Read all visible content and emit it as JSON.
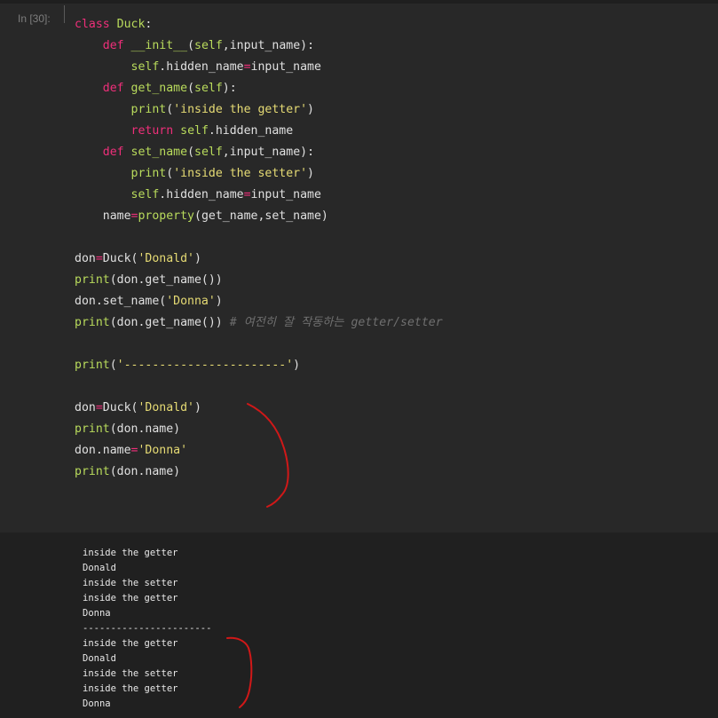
{
  "cell": {
    "prompt": "In [30]:",
    "code_lines": [
      [
        {
          "t": "kw",
          "v": "class"
        },
        {
          "t": "txt",
          "v": " "
        },
        {
          "t": "cls",
          "v": "Duck"
        },
        {
          "t": "txt",
          "v": ":"
        }
      ],
      [
        {
          "t": "txt",
          "v": "    "
        },
        {
          "t": "kw",
          "v": "def"
        },
        {
          "t": "txt",
          "v": " "
        },
        {
          "t": "bi",
          "v": "__init__"
        },
        {
          "t": "txt",
          "v": "("
        },
        {
          "t": "self",
          "v": "self"
        },
        {
          "t": "txt",
          "v": ",input_name):"
        }
      ],
      [
        {
          "t": "txt",
          "v": "        "
        },
        {
          "t": "self",
          "v": "self"
        },
        {
          "t": "txt",
          "v": ".hidden_name"
        },
        {
          "t": "op",
          "v": "="
        },
        {
          "t": "txt",
          "v": "input_name"
        }
      ],
      [
        {
          "t": "txt",
          "v": "    "
        },
        {
          "t": "kw",
          "v": "def"
        },
        {
          "t": "txt",
          "v": " "
        },
        {
          "t": "bi",
          "v": "get_name"
        },
        {
          "t": "txt",
          "v": "("
        },
        {
          "t": "self",
          "v": "self"
        },
        {
          "t": "txt",
          "v": "):"
        }
      ],
      [
        {
          "t": "txt",
          "v": "        "
        },
        {
          "t": "bi",
          "v": "print"
        },
        {
          "t": "txt",
          "v": "("
        },
        {
          "t": "str",
          "v": "'inside the getter'"
        },
        {
          "t": "txt",
          "v": ")"
        }
      ],
      [
        {
          "t": "txt",
          "v": "        "
        },
        {
          "t": "kw",
          "v": "return"
        },
        {
          "t": "txt",
          "v": " "
        },
        {
          "t": "self",
          "v": "self"
        },
        {
          "t": "txt",
          "v": ".hidden_name"
        }
      ],
      [
        {
          "t": "txt",
          "v": "    "
        },
        {
          "t": "kw",
          "v": "def"
        },
        {
          "t": "txt",
          "v": " "
        },
        {
          "t": "bi",
          "v": "set_name"
        },
        {
          "t": "txt",
          "v": "("
        },
        {
          "t": "self",
          "v": "self"
        },
        {
          "t": "txt",
          "v": ",input_name):"
        }
      ],
      [
        {
          "t": "txt",
          "v": "        "
        },
        {
          "t": "bi",
          "v": "print"
        },
        {
          "t": "txt",
          "v": "("
        },
        {
          "t": "str",
          "v": "'inside the setter'"
        },
        {
          "t": "txt",
          "v": ")"
        }
      ],
      [
        {
          "t": "txt",
          "v": "        "
        },
        {
          "t": "self",
          "v": "self"
        },
        {
          "t": "txt",
          "v": ".hidden_name"
        },
        {
          "t": "op",
          "v": "="
        },
        {
          "t": "txt",
          "v": "input_name"
        }
      ],
      [
        {
          "t": "txt",
          "v": "    name"
        },
        {
          "t": "op",
          "v": "="
        },
        {
          "t": "bi",
          "v": "property"
        },
        {
          "t": "txt",
          "v": "(get_name,set_name)"
        }
      ],
      [],
      [
        {
          "t": "txt",
          "v": "don"
        },
        {
          "t": "op",
          "v": "="
        },
        {
          "t": "txt",
          "v": "Duck("
        },
        {
          "t": "str",
          "v": "'Donald'"
        },
        {
          "t": "txt",
          "v": ")"
        }
      ],
      [
        {
          "t": "bi",
          "v": "print"
        },
        {
          "t": "txt",
          "v": "(don.get_name())"
        }
      ],
      [
        {
          "t": "txt",
          "v": "don.set_name("
        },
        {
          "t": "str",
          "v": "'Donna'"
        },
        {
          "t": "txt",
          "v": ")"
        }
      ],
      [
        {
          "t": "bi",
          "v": "print"
        },
        {
          "t": "txt",
          "v": "(don.get_name()) "
        },
        {
          "t": "cmt",
          "v": "# 여전히 잘 작동하는 getter/setter"
        }
      ],
      [],
      [
        {
          "t": "bi",
          "v": "print"
        },
        {
          "t": "txt",
          "v": "("
        },
        {
          "t": "str",
          "v": "'-----------------------'"
        },
        {
          "t": "txt",
          "v": ")"
        }
      ],
      [],
      [
        {
          "t": "txt",
          "v": "don"
        },
        {
          "t": "op",
          "v": "="
        },
        {
          "t": "txt",
          "v": "Duck("
        },
        {
          "t": "str",
          "v": "'Donald'"
        },
        {
          "t": "txt",
          "v": ")"
        }
      ],
      [
        {
          "t": "bi",
          "v": "print"
        },
        {
          "t": "txt",
          "v": "(don.name)"
        }
      ],
      [
        {
          "t": "txt",
          "v": "don.name"
        },
        {
          "t": "op",
          "v": "="
        },
        {
          "t": "str",
          "v": "'Donna'"
        }
      ],
      [
        {
          "t": "bi",
          "v": "print"
        },
        {
          "t": "txt",
          "v": "(don.name)"
        }
      ]
    ]
  },
  "output_lines": [
    "inside the getter",
    "Donald",
    "inside the setter",
    "inside the getter",
    "Donna",
    "-----------------------",
    "inside the getter",
    "Donald",
    "inside the setter",
    "inside the getter",
    "Donna"
  ],
  "colors": {
    "background": "#282828",
    "output_background": "#202020",
    "keyword": "#ef2f7a",
    "builtin": "#b9db5c",
    "string": "#e6db74",
    "comment": "#6f6f6f",
    "annotation": "#d01818"
  }
}
